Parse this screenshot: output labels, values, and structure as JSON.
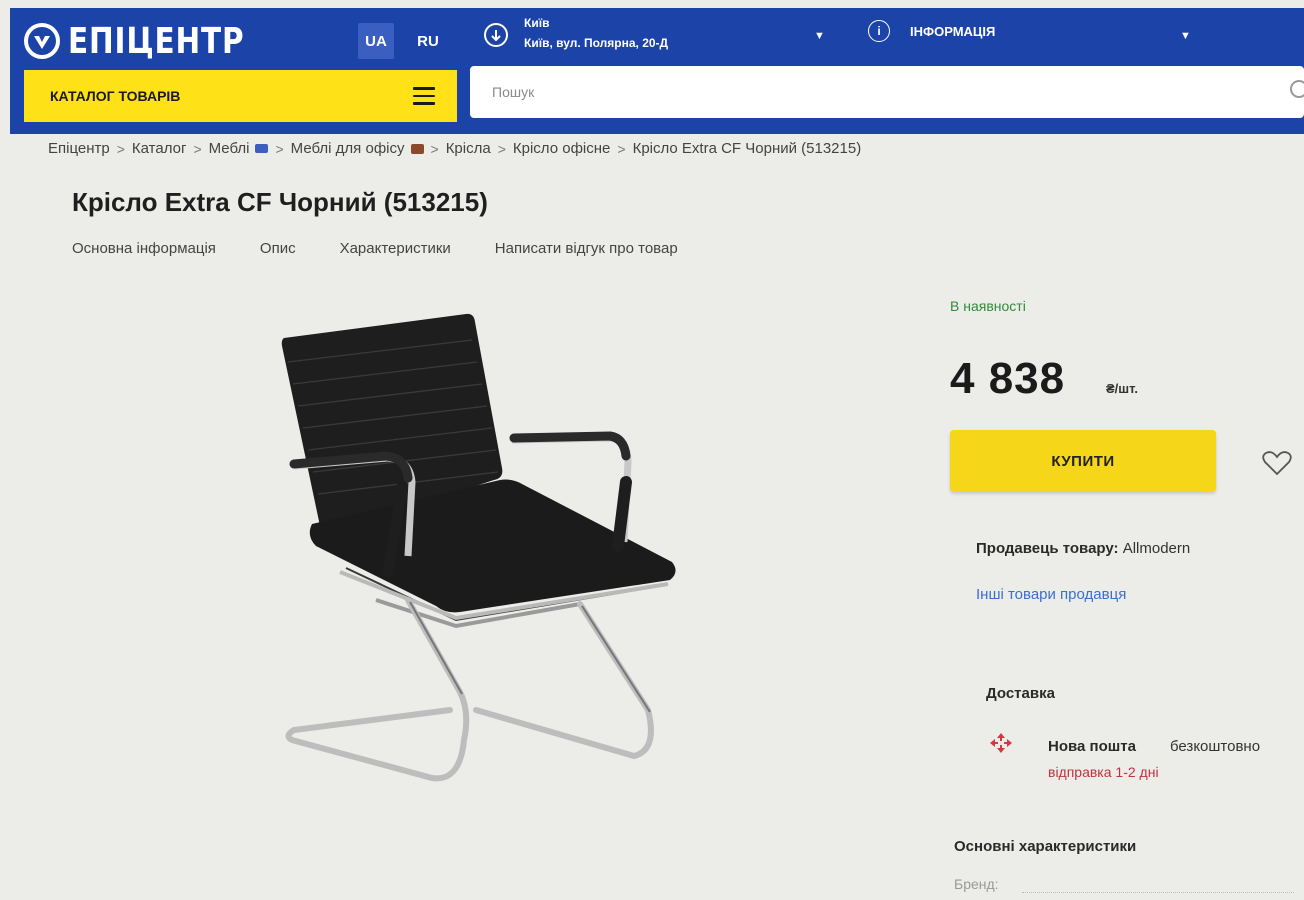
{
  "header": {
    "logo_text": "ЕПІЦЕНТР",
    "lang_ua": "UA",
    "lang_ru": "RU",
    "location_city": "Київ",
    "location_address": "Київ, вул. Полярна, 20-Д",
    "info_label": "ІНФОРМАЦІЯ",
    "catalog_label": "КАТАЛОГ ТОВАРІВ",
    "search_placeholder": "Пошук",
    "colors": {
      "header_bg": "#1c44a8",
      "catalog_bg": "#ffe118"
    },
    "icons": [
      "logo-mark-icon",
      "location-icon",
      "chevron-down-icon",
      "info-icon",
      "burger-menu-icon",
      "search-icon"
    ]
  },
  "breadcrumb": {
    "items": [
      "Епіцентр",
      "Каталог",
      "Меблі",
      "Меблі для офісу",
      "Крісла",
      "Крісло офісне",
      "Крісло Extra CF Чорний (513215)"
    ],
    "separator": ">"
  },
  "product": {
    "title": "Крісло Extra CF Чорний (513215)",
    "tabs": [
      "Основна інформація",
      "Опис",
      "Характеристики",
      "Написати відгук про товар"
    ],
    "stock_status": "В наявності",
    "price": "4 838",
    "price_unit": "₴/шт.",
    "buy_label": "КУПИТИ",
    "seller_label": "Продавець товару:",
    "seller_name": "Allmodern",
    "seller_link": "Інші товари продавця",
    "colors": {
      "buy_button": "#f6d618",
      "in_stock": "#2e8b3a",
      "delivery_time": "#c0333c"
    }
  },
  "delivery": {
    "heading": "Доставка",
    "carrier": "Нова пошта",
    "cost": "безкоштовно",
    "time": "відправка 1-2 дні"
  },
  "characteristics": {
    "heading": "Основні характеристики",
    "brand_label": "Бренд:"
  }
}
